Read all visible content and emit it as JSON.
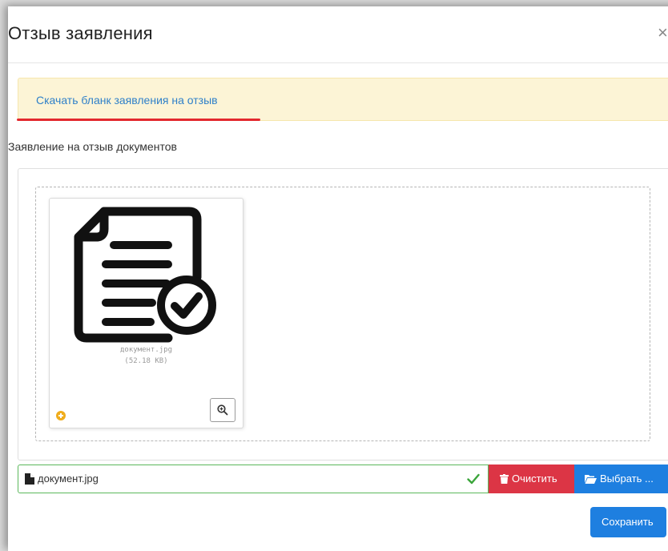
{
  "modal": {
    "title": "Отзыв заявления",
    "close_label": "×"
  },
  "alert": {
    "link_text": "Скачать бланк заявления на отзыв"
  },
  "form": {
    "field_label": "Заявление на отзыв документов"
  },
  "preview": {
    "file_name": "документ.jpg",
    "file_size": "(52.18 KB)",
    "icon": "document-check-icon"
  },
  "file_input": {
    "caption": "документ.jpg",
    "clear_label": "Очистить",
    "browse_label": "Выбрать ..."
  },
  "footer": {
    "save_label": "Сохранить"
  },
  "colors": {
    "alert_bg": "#fcf4d6",
    "link": "#2f80c9",
    "success": "#5cb85c",
    "danger": "#dc3545",
    "primary": "#1e7fe0",
    "annotation_underline": "#e3282e"
  }
}
